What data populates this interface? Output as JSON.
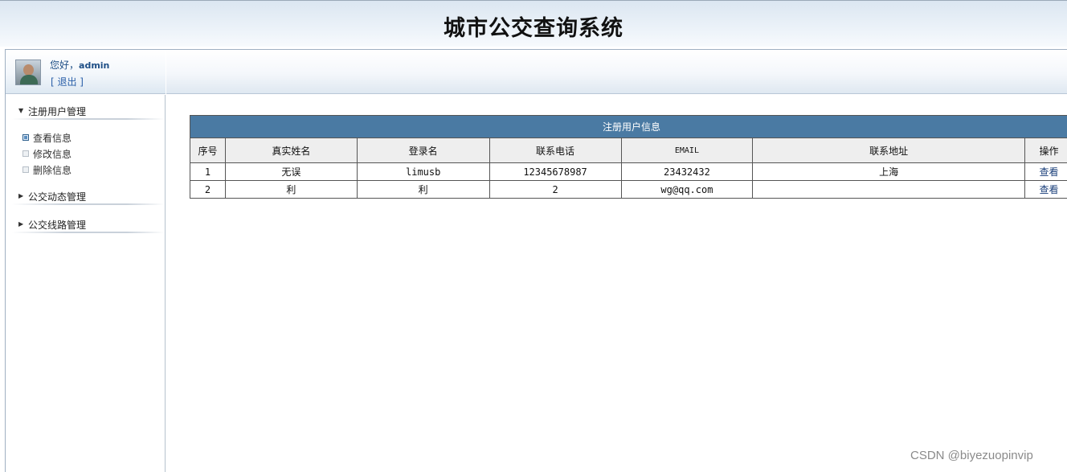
{
  "header": {
    "title": "城市公交查询系统"
  },
  "user": {
    "greeting": "您好，",
    "name": "admin",
    "logout": "[ 退出 ]"
  },
  "sidebar": {
    "groups": [
      {
        "label": "注册用户管理",
        "expanded": true,
        "items": [
          {
            "label": "查看信息",
            "active": true
          },
          {
            "label": "修改信息"
          },
          {
            "label": "删除信息"
          }
        ]
      },
      {
        "label": "公交动态管理",
        "expanded": false
      },
      {
        "label": "公交线路管理",
        "expanded": false
      }
    ]
  },
  "table": {
    "title": "注册用户信息",
    "columns": [
      "序号",
      "真实姓名",
      "登录名",
      "联系电话",
      "EMAIL",
      "联系地址",
      "操作"
    ],
    "rows": [
      [
        "1",
        "无误",
        "limusb",
        "12345678987",
        "23432432",
        "上海",
        "查看"
      ],
      [
        "2",
        "利",
        "利",
        "2",
        "wg@qq.com",
        "",
        "查看"
      ]
    ]
  },
  "watermark": "CSDN @biyezuopinvip",
  "colors": {
    "table_title_bg": "#4a7aa3",
    "header_bg": "#dbe6f1",
    "link": "#1a3f7a"
  }
}
